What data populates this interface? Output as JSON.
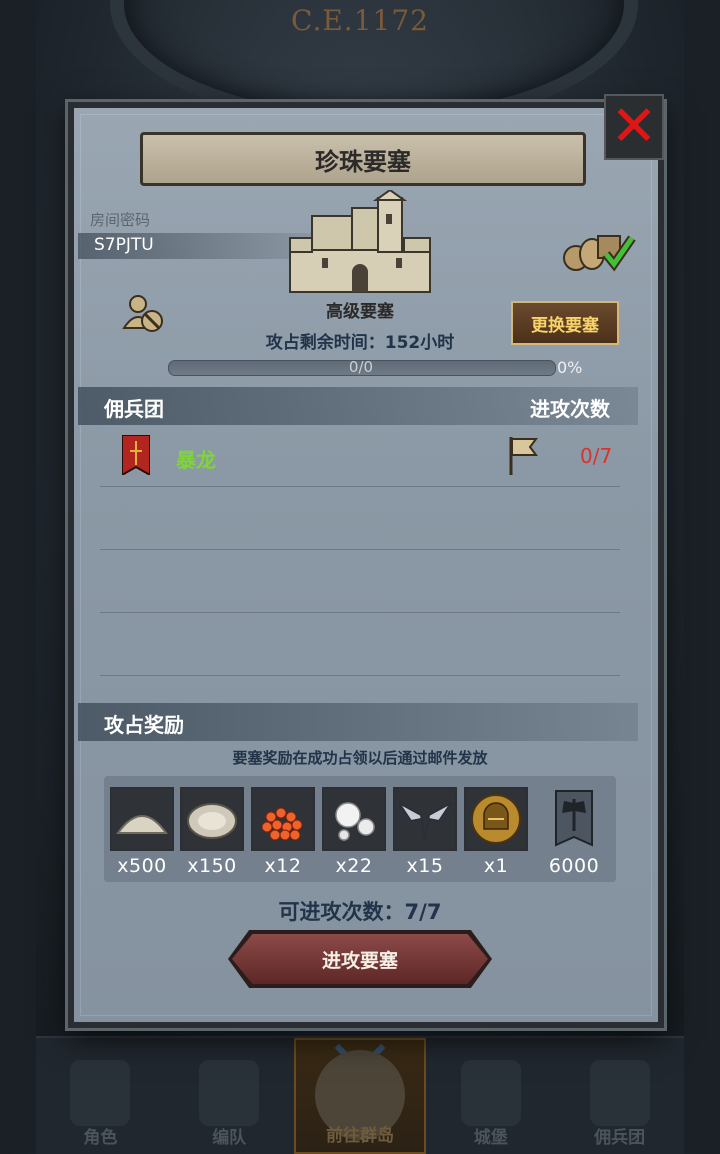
{
  "background": {
    "year": "C.E.1172"
  },
  "dialog": {
    "title": "珍珠要塞",
    "room_code_label": "房间密码",
    "room_code": "S7PJTU",
    "fortress_grade": "高级要塞",
    "change_button": "更换要塞",
    "time_remaining": "攻占剩余时间：152小时",
    "progress_text": "0/0",
    "progress_percent_label": "0%",
    "progress_value": 0,
    "mercenary_header": "佣兵团",
    "attacks_header": "进攻次数",
    "mercenaries": [
      {
        "name": "暴龙",
        "attacks": "0/7"
      }
    ],
    "rewards_header": "攻占奖励",
    "rewards_note": "要塞奖励在成功占领以后通过邮件发放",
    "rewards": [
      {
        "icon": "sand-pile-icon",
        "qty": "x500"
      },
      {
        "icon": "oyster-icon",
        "qty": "x150"
      },
      {
        "icon": "fish-roe-icon",
        "qty": "x12"
      },
      {
        "icon": "pearls-icon",
        "qty": "x22"
      },
      {
        "icon": "winged-emblem-icon",
        "qty": "x15"
      },
      {
        "icon": "helmet-coin-icon",
        "qty": "x1"
      },
      {
        "icon": "axe-banner-icon",
        "qty": "6000"
      }
    ],
    "attacks_available": "可进攻次数：7/7",
    "attack_button": "进攻要塞"
  },
  "bottom_nav": [
    {
      "label": "角色",
      "active": false
    },
    {
      "label": "编队",
      "active": false
    },
    {
      "label": "前往群岛",
      "active": true
    },
    {
      "label": "城堡",
      "active": false
    },
    {
      "label": "佣兵团",
      "active": false
    }
  ],
  "colors": {
    "accent_gold": "#f7d36a",
    "merc_name_green": "#7ed43a",
    "attacks_red": "#d7342c",
    "close_red": "#e01616"
  }
}
